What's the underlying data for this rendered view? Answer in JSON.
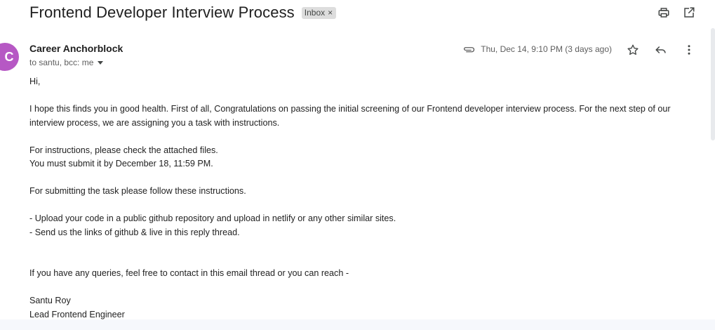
{
  "email": {
    "subject": "Frontend Developer Interview Process",
    "label": "Inbox",
    "label_remove": "×",
    "sender_initial": "C",
    "sender_name": "Career Anchorblock",
    "recipients": "to santu, bcc: me",
    "date": "Thu, Dec 14, 9:10 PM (3 days ago)",
    "body": {
      "greeting": "Hi,",
      "para1": "I hope this finds you in good health. First of all, Congratulations on passing the initial screening of our Frontend developer interview process. For the next step of our interview process, we are assigning you a task with instructions.",
      "instr1": "For instructions, please check the attached files.",
      "instr2": "You must submit it by December 18, 11:59 PM.",
      "submit_intro": "For submitting the task please follow these instructions.",
      "bullet1": "- Upload your code in a public github repository and upload in netlify or any other similar sites.",
      "bullet2": "- Send us the links of github & live in this reply thread.",
      "queries": "If you have any queries, feel free to contact in this email thread or you can reach -",
      "sig_name": "Santu Roy",
      "sig_title": "Lead Frontend Engineer"
    }
  },
  "icons": {
    "print": "print-icon",
    "open_new": "open-in-new-icon",
    "attachment": "paperclip-icon",
    "star": "star-icon",
    "reply": "reply-icon",
    "more": "more-vert-icon"
  },
  "colors": {
    "avatar": "#b658c4",
    "chip_bg": "#dddddd",
    "text": "#222222"
  }
}
